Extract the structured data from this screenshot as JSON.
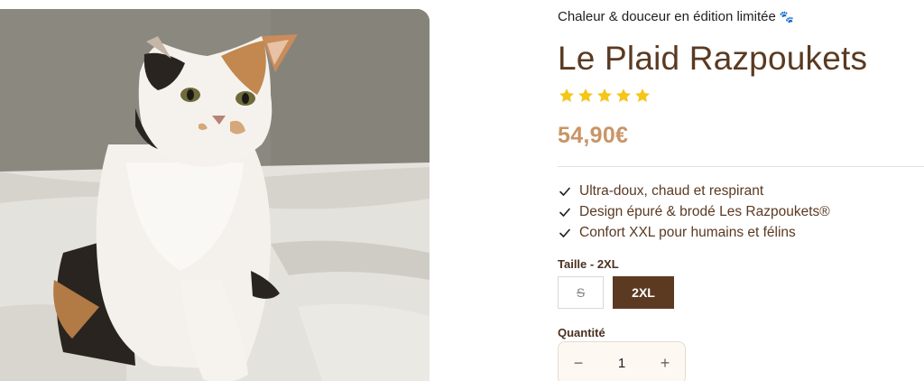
{
  "product": {
    "tagline": "Chaleur & douceur en édition limitée",
    "title": "Le Plaid Razpoukets",
    "rating": 5,
    "rating_max": 5,
    "star_color": "#f5c518",
    "price": "54,90€",
    "features": [
      "Ultra-doux, chaud et respirant",
      "Design épuré & brodé Les Razpoukets®",
      "Confort XXL pour humains et félins"
    ]
  },
  "size_option": {
    "label": "Taille - 2XL",
    "options": [
      {
        "label": "S",
        "available": false,
        "selected": false
      },
      {
        "label": "2XL",
        "available": true,
        "selected": true
      }
    ]
  },
  "quantity": {
    "label": "Quantité",
    "value": "1",
    "minus_icon": "minus-icon",
    "plus_icon": "plus-icon"
  },
  "colors": {
    "brand_brown": "#5c3a22",
    "price_tan": "#c89566"
  }
}
